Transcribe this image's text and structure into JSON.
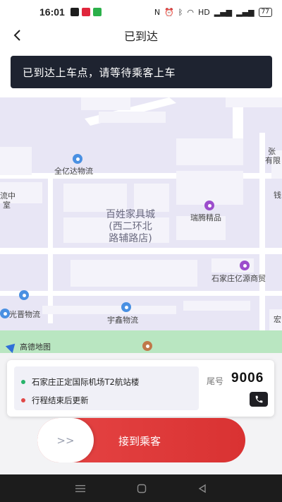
{
  "status_bar": {
    "time": "16:01",
    "battery": "77",
    "icons": [
      "wechat-icon",
      "weibo-icon",
      "message-icon",
      "nfc-icon",
      "alarm-icon",
      "bluetooth-icon",
      "wifi-icon",
      "hd-icon",
      "signal-icon",
      "battery-icon"
    ]
  },
  "nav": {
    "title": "已到达"
  },
  "banner": {
    "text": "已到达上车点，请等待乘客上车"
  },
  "map": {
    "pois": [
      {
        "name": "全亿达物流",
        "color": "#4a90e2"
      },
      {
        "name": "瑞腾精品",
        "color": "#9c4dcc"
      },
      {
        "name": "石家庄亿源商贸",
        "color": "#9c4dcc"
      },
      {
        "name": "光晋物流",
        "color": "#4a90e2"
      },
      {
        "name": "宇鑫物流",
        "color": "#4a90e2"
      }
    ],
    "area_label_lines": [
      "百姓家具城",
      "(西二环北",
      "路辅路店)"
    ],
    "edge_labels": {
      "left_top": "流中",
      "left_bottom": "室",
      "right_top": "张",
      "right_mid": "有限",
      "right_bottom": "钱",
      "right_far": "宏"
    },
    "logo_text": "高德地图"
  },
  "trip": {
    "pickup": "石家庄正定国际机场T2航站楼",
    "destination": "行程结束后更新",
    "pickup_color": "#27b36a",
    "destination_color": "#e04848",
    "tail_label": "尾号",
    "tail_number": "9006"
  },
  "action": {
    "knob_symbol": ">>",
    "label": "接到乘客",
    "color": "#e03c3c"
  }
}
